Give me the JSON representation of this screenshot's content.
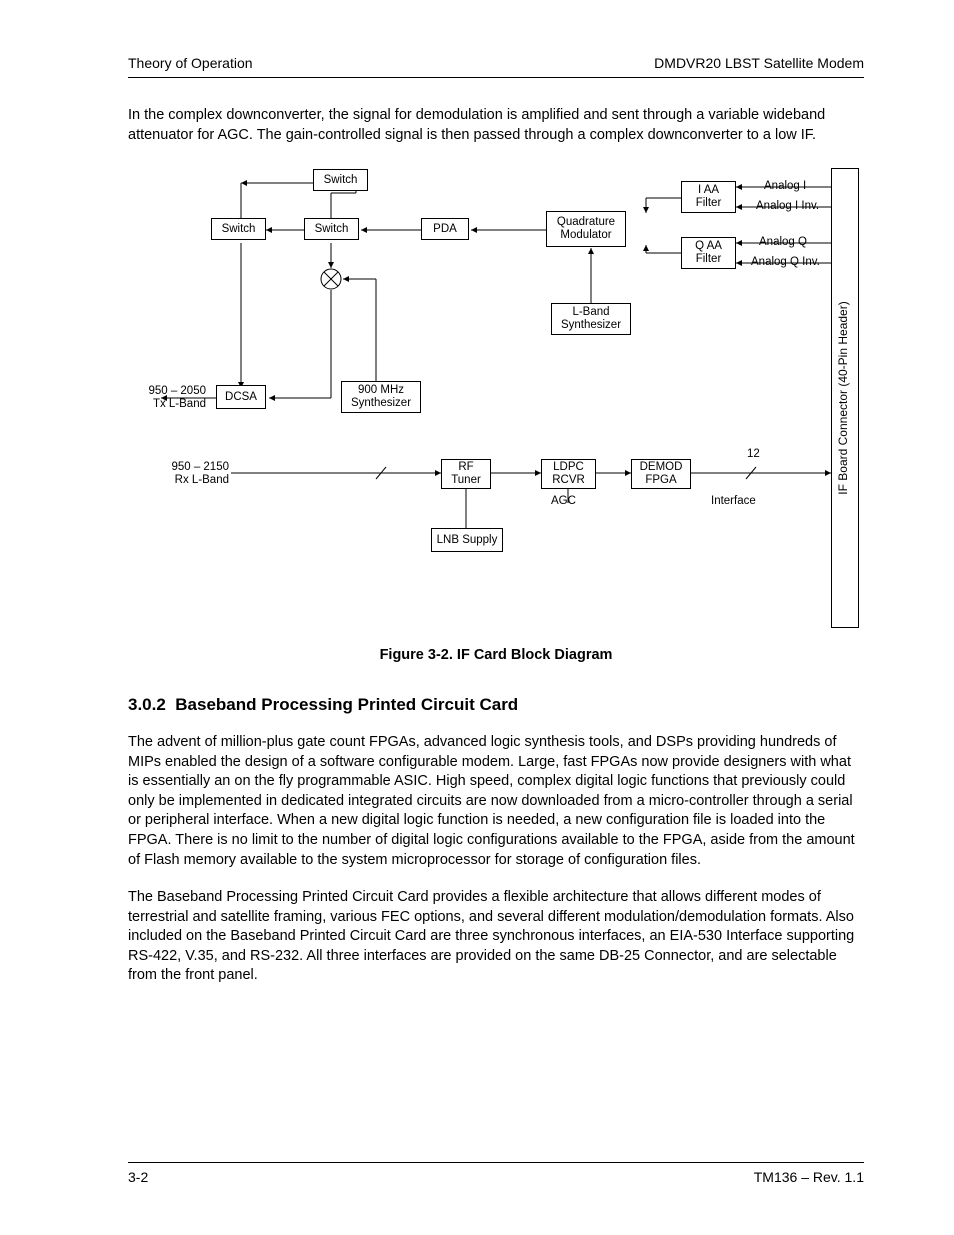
{
  "header": {
    "left": "Theory of Operation",
    "right": "DMDVR20 LBST Satellite Modem"
  },
  "intro_para": "In the complex downconverter, the signal for demodulation is amplified and sent through a variable wideband attenuator for AGC.  The gain-controlled signal is then passed through a complex downconverter to a low IF.",
  "figure": {
    "caption": "Figure 3-2.  IF Card Block Diagram",
    "labels": {
      "switch1": "Switch",
      "switch2": "Switch",
      "switch3": "Switch",
      "pda": "PDA",
      "quad_mod": "Quadrature Modulator",
      "i_aa": "I AA Filter",
      "q_aa": "Q AA Filter",
      "lband_synth": "L-Band Synthesizer",
      "dcsa": "DCSA",
      "synth900": "900 MHz Synthesizer",
      "rf_tuner": "RF Tuner",
      "ldpc_rcvr": "LDPC RCVR",
      "demod_fpga": "DEMOD FPGA",
      "lnb": "LNB Supply",
      "agc": "AGC",
      "interface": "Interface",
      "twelve": "12",
      "tx_lband": "950 – 2050\nTx L-Band",
      "rx_lband": "950 – 2150\nRx L-Band",
      "analog_i": "Analog I",
      "analog_i_inv": "Analog I Inv.",
      "analog_q": "Analog Q",
      "analog_q_inv": "Analog Q Inv.",
      "connector": "IF Board Connector (40-Pin Header)"
    }
  },
  "section": {
    "number": "3.0.2",
    "title": "Baseband Processing Printed Circuit Card",
    "para1": "The advent of million-plus gate count FPGAs, advanced logic synthesis tools, and DSPs providing hundreds of MIPs enabled the design of a software configurable modem.  Large, fast FPGAs now provide designers with what is essentially an on the fly programmable ASIC.  High speed, complex digital logic functions that previously could only be implemented in dedicated integrated circuits are now downloaded from a micro-controller through a serial or peripheral interface.  When a new digital logic function is needed, a new configuration file is loaded into the FPGA.  There is no limit to the number of digital logic configurations available to the FPGA, aside from the amount of Flash memory available to the system microprocessor for storage of configuration files.",
    "para2": "The Baseband Processing Printed Circuit Card provides a flexible architecture that allows different modes of terrestrial and satellite framing, various FEC options, and several different modulation/demodulation formats.  Also included on the Baseband Printed Circuit Card are three synchronous interfaces, an EIA-530 Interface supporting RS-422, V.35, and RS-232.  All three interfaces are provided on the same DB-25 Connector, and are selectable from the front panel."
  },
  "footer": {
    "left": "3-2",
    "right": "TM136 – Rev. 1.1"
  }
}
